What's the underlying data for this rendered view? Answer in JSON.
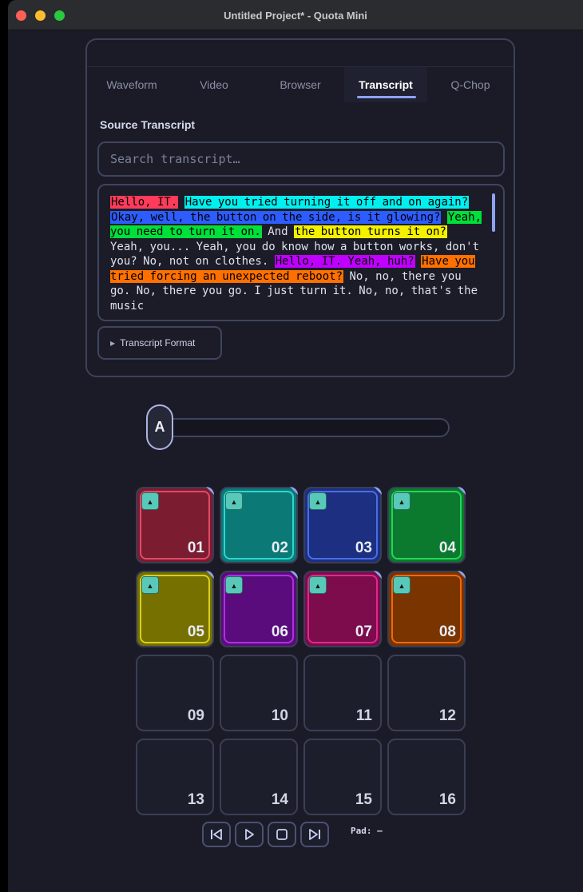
{
  "window": {
    "title": "Untitled Project* - Quota Mini"
  },
  "tabs": [
    {
      "label": "Waveform",
      "active": false
    },
    {
      "label": "Video",
      "active": false
    },
    {
      "label": "Browser",
      "active": false
    },
    {
      "label": "Transcript",
      "active": true
    },
    {
      "label": "Q-Chop",
      "active": false
    }
  ],
  "transcript_panel": {
    "section_label": "Source Transcript",
    "search_placeholder": "Search transcript…",
    "segments": [
      {
        "text": "Hello, IT.",
        "color": "#ff3b5c"
      },
      {
        "text": " ",
        "color": ""
      },
      {
        "text": "Have you tried turning it off and on again?",
        "color": "#00f0f0"
      },
      {
        "text": " ",
        "color": ""
      },
      {
        "text": "Okay, well, the button on the side, is it glowing?",
        "color": "#2d5cff"
      },
      {
        "text": " ",
        "color": ""
      },
      {
        "text": "Yeah, you need to turn it on.",
        "color": "#00e03a"
      },
      {
        "text": " And ",
        "color": ""
      },
      {
        "text": "the button turns it on?",
        "color": "#f4f000"
      },
      {
        "text": " Yeah, you... Yeah, you do know how a button works, don't you? No, not on clothes. ",
        "color": ""
      },
      {
        "text": "Hello, IT. Yeah, huh?",
        "color": "#c000ff"
      },
      {
        "text": " ",
        "color": ""
      },
      {
        "text": "Have you tried forcing an unexpected reboot?",
        "color": "#ff7000"
      },
      {
        "text": " No, no, there you go. No, there you go. I just turn it. No, no, that's the music",
        "color": ""
      }
    ],
    "format_button": "Transcript Format"
  },
  "slider": {
    "knob_label": "A",
    "value": 0
  },
  "pads": [
    {
      "label": "01",
      "color": "#7c1c30",
      "border": "#e04a6a",
      "loaded": true
    },
    {
      "label": "02",
      "color": "#0b7a76",
      "border": "#2ed6d0",
      "loaded": true
    },
    {
      "label": "03",
      "color": "#1c2f80",
      "border": "#4a6ee6",
      "loaded": true
    },
    {
      "label": "04",
      "color": "#0b7a2e",
      "border": "#26d65a",
      "loaded": true
    },
    {
      "label": "05",
      "color": "#757000",
      "border": "#d6d020",
      "loaded": true
    },
    {
      "label": "06",
      "color": "#5a0c7c",
      "border": "#b030e0",
      "loaded": true
    },
    {
      "label": "07",
      "color": "#7c0c4c",
      "border": "#e02a8a",
      "loaded": true
    },
    {
      "label": "08",
      "color": "#7a3400",
      "border": "#f06a10",
      "loaded": true
    },
    {
      "label": "09",
      "color": "",
      "border": "",
      "loaded": false
    },
    {
      "label": "10",
      "color": "",
      "border": "",
      "loaded": false
    },
    {
      "label": "11",
      "color": "",
      "border": "",
      "loaded": false
    },
    {
      "label": "12",
      "color": "",
      "border": "",
      "loaded": false
    },
    {
      "label": "13",
      "color": "",
      "border": "",
      "loaded": false
    },
    {
      "label": "14",
      "color": "",
      "border": "",
      "loaded": false
    },
    {
      "label": "15",
      "color": "",
      "border": "",
      "loaded": false
    },
    {
      "label": "16",
      "color": "",
      "border": "",
      "loaded": false
    }
  ],
  "pad_icon": "play-triangle-icon",
  "transport": [
    {
      "name": "skip-back-button",
      "icon": "skip-back-icon"
    },
    {
      "name": "play-button",
      "icon": "play-icon"
    },
    {
      "name": "stop-button",
      "icon": "stop-icon"
    },
    {
      "name": "skip-forward-button",
      "icon": "skip-forward-icon"
    }
  ],
  "pad_readout": "Pad: —"
}
